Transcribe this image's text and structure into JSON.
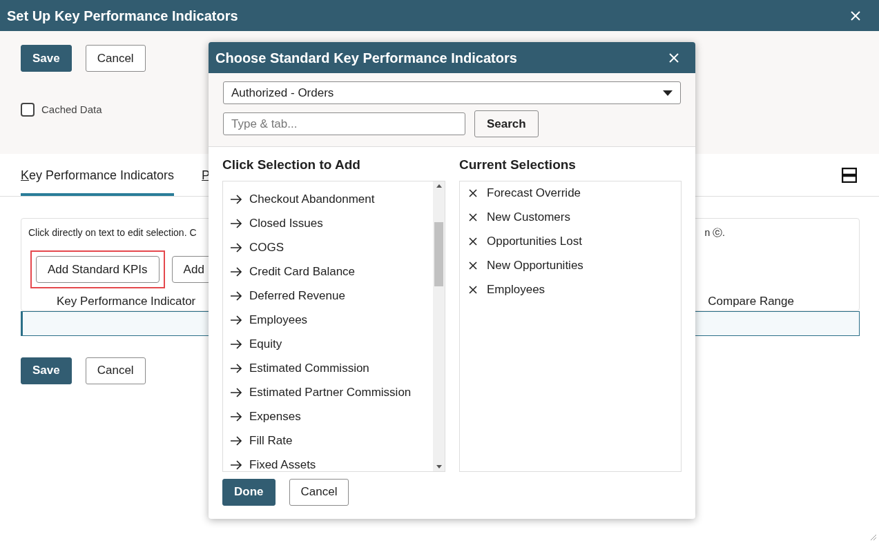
{
  "window": {
    "title": "Set Up Key Performance Indicators"
  },
  "top_buttons": [
    "Save",
    "Cancel"
  ],
  "cached_data": {
    "label": "Cached Data",
    "checked": false
  },
  "tabs": [
    {
      "label": "Key Performance Indicators",
      "selected": true
    },
    {
      "label": "P",
      "selected": false
    }
  ],
  "instructions": {
    "start": "Click directly on text to edit selection. C",
    "end": "n ⓒ."
  },
  "add_buttons": [
    {
      "label": "Add Standard KPIs",
      "highlighted": true
    },
    {
      "label": "Add",
      "highlighted": false
    }
  ],
  "table": {
    "columns": [
      "Key Performance Indicator",
      "Compare Range"
    ]
  },
  "bottom_buttons": [
    "Save",
    "Cancel"
  ],
  "dialog": {
    "title": "Choose Standard Key Performance Indicators",
    "filter": "Authorized - Orders",
    "search_placeholder": "Type & tab...",
    "search_button": "Search",
    "available_heading": "Click Selection to Add",
    "available": [
      "Checkout Abandonment",
      "Closed Issues",
      "COGS",
      "Credit Card Balance",
      "Deferred Revenue",
      "Employees",
      "Equity",
      "Estimated Commission",
      "Estimated Partner Commission",
      "Expenses",
      "Fill Rate",
      "Fixed Assets"
    ],
    "selected_heading": "Current Selections",
    "selected": [
      "Forecast Override",
      "New Customers",
      "Opportunities Lost",
      "New Opportunities",
      "Employees"
    ],
    "buttons": [
      {
        "label": "Done",
        "kind": "primary"
      },
      {
        "label": "Cancel",
        "kind": "secondary"
      }
    ]
  }
}
